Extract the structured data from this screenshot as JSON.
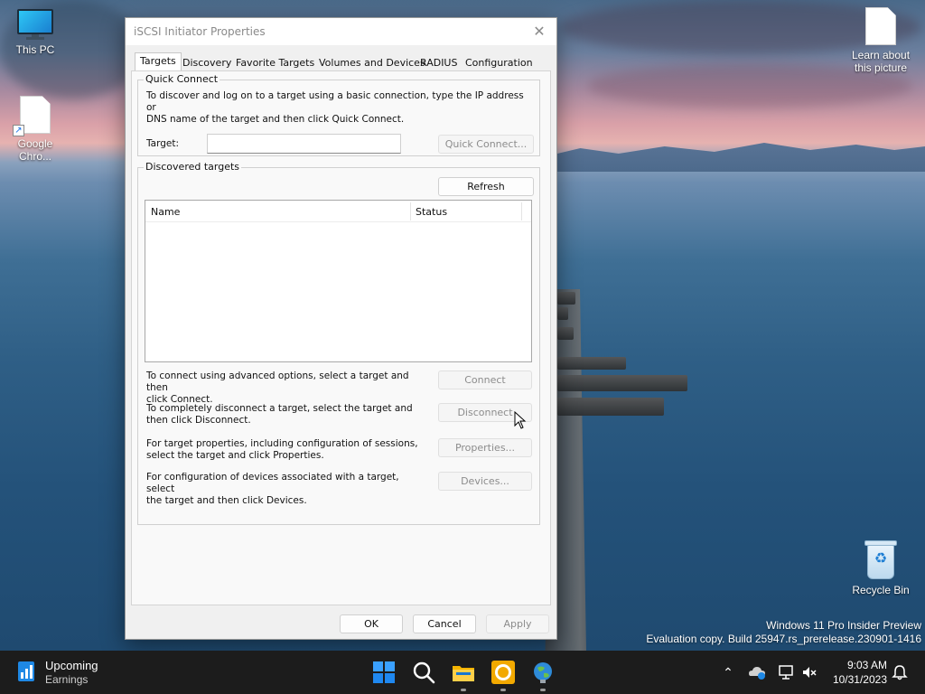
{
  "desktop": {
    "icons": {
      "this_pc": "This PC",
      "chrome_line1": "Google",
      "chrome_line2": "Chro...",
      "learn_line1": "Learn about",
      "learn_line2": "this picture",
      "recycle_bin": "Recycle Bin"
    },
    "watermark": {
      "line1": "Windows 11 Pro Insider Preview",
      "line2": "Evaluation copy. Build 25947.rs_prerelease.230901-1416"
    }
  },
  "dialog": {
    "title": "iSCSI Initiator Properties",
    "tabs": [
      "Targets",
      "Discovery",
      "Favorite Targets",
      "Volumes and Devices",
      "RADIUS",
      "Configuration"
    ],
    "active_tab": "Targets",
    "quick_connect": {
      "group_label": "Quick Connect",
      "description_line1": "To discover and log on to a target using a basic connection, type the IP address or",
      "description_line2": "DNS name of the target and then click Quick Connect.",
      "target_label": "Target:",
      "target_value": "",
      "button": "Quick Connect..."
    },
    "discovered": {
      "group_label": "Discovered targets",
      "refresh_button": "Refresh",
      "columns": [
        "Name",
        "Status"
      ],
      "rows": []
    },
    "actions": [
      {
        "text_line1": "To connect using advanced options, select a target and then",
        "text_line2": "click Connect.",
        "button": "Connect"
      },
      {
        "text_line1": "To completely disconnect a target, select the target and",
        "text_line2": "then click Disconnect.",
        "button": "Disconnect"
      },
      {
        "text_line1": "For target properties, including configuration of sessions,",
        "text_line2": "select the target and click Properties.",
        "button": "Properties..."
      },
      {
        "text_line1": "For configuration of devices associated with a target, select",
        "text_line2": "the target and then click Devices.",
        "button": "Devices..."
      }
    ],
    "footer": {
      "ok": "OK",
      "cancel": "Cancel",
      "apply": "Apply"
    }
  },
  "taskbar": {
    "widget": {
      "line1": "Upcoming",
      "line2": "Earnings"
    },
    "apps": [
      "start-icon",
      "search-icon",
      "file-explorer-icon",
      "chrome-icon",
      "network-globe-icon"
    ],
    "clock": {
      "time": "9:03 AM",
      "date": "10/31/2023"
    }
  },
  "colors": {
    "taskbar_bg": "#1c1c1c",
    "dialog_bg": "#f0f0f0",
    "accent_blue": "#0078d4"
  }
}
